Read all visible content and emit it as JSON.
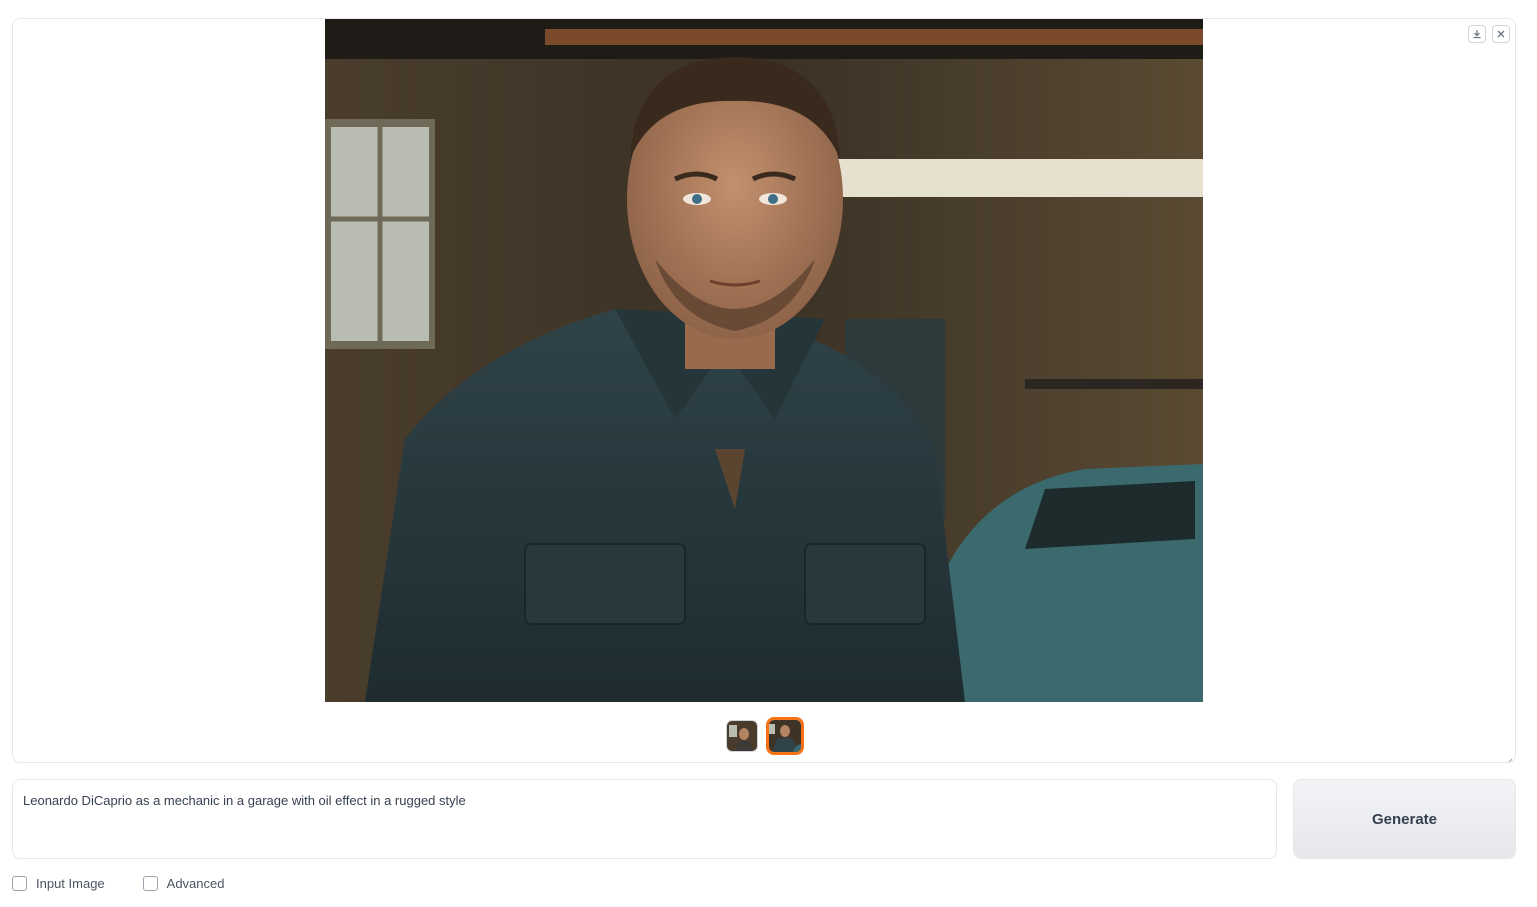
{
  "gallery": {
    "main_image_alt": "generated-image",
    "download_icon": "download-icon",
    "close_icon": "close-icon",
    "thumbnails": [
      {
        "icon": "image-thumbnail",
        "selected": false
      },
      {
        "icon": "image-thumbnail",
        "selected": true
      }
    ]
  },
  "prompt": {
    "value": "Leonardo DiCaprio as a mechanic in a garage with oil effect in a rugged style"
  },
  "generate_label": "Generate",
  "options": {
    "input_image_label": "Input Image",
    "advanced_label": "Advanced"
  },
  "colors": {
    "accent": "#f97316",
    "border": "#e5e7eb"
  }
}
